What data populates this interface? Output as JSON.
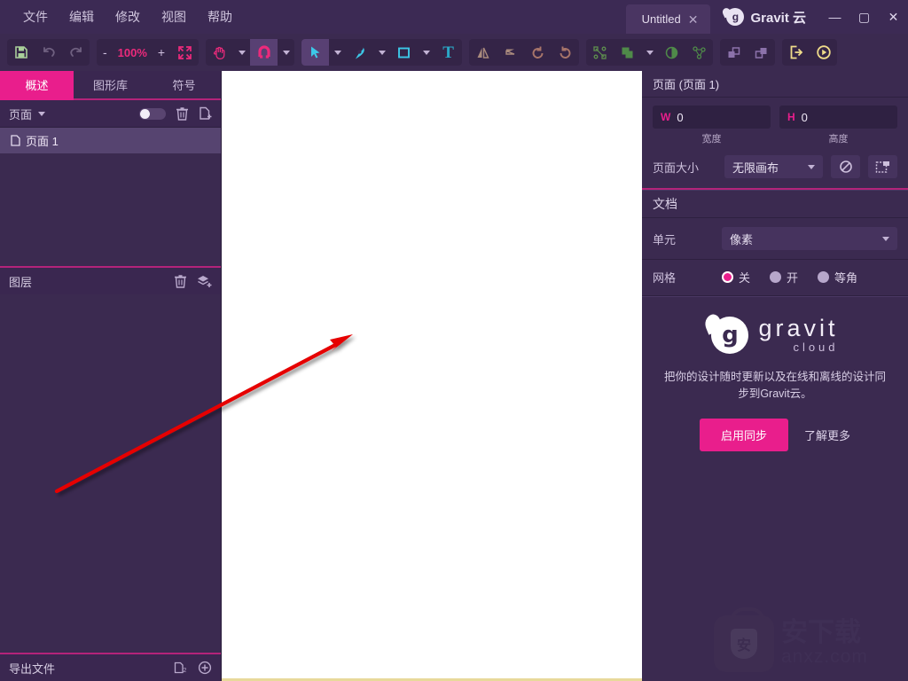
{
  "window": {
    "menus": [
      "文件",
      "编辑",
      "修改",
      "视图",
      "帮助"
    ],
    "document_tab": "Untitled",
    "document_tab_close": "✕",
    "brand": "Gravit 云",
    "brand_logo_letter": "g",
    "minimize": "—",
    "maximize": "▢",
    "close": "✕"
  },
  "toolbar": {
    "zoom_minus": "-",
    "zoom_value": "100%",
    "zoom_plus": "+",
    "icons": {
      "save": "save-icon",
      "undo": "undo-icon",
      "redo": "redo-icon",
      "fit": "fit-screen-icon",
      "hand": "hand-tool-icon",
      "magnet": "magnet-snap-icon",
      "select": "pointer-tool-icon",
      "pen": "pen-tool-icon",
      "rect": "rectangle-tool-icon",
      "text": "text-tool-icon",
      "flip_h": "flip-horizontal-icon",
      "flip_v": "flip-vertical-icon",
      "rotate_ccw": "rotate-left-icon",
      "rotate_cw": "rotate-right-icon",
      "node": "node-edit-icon",
      "boolean": "boolean-union-icon",
      "mask": "mask-icon",
      "distribute": "distribute-icon",
      "bring_forward": "bring-forward-icon",
      "send_backward": "send-backward-icon",
      "export": "export-icon",
      "preview": "preview-play-icon"
    },
    "text_tool_label": "T"
  },
  "left_panel": {
    "tabs": [
      {
        "label": "概述",
        "active": true
      },
      {
        "label": "图形库",
        "active": false
      },
      {
        "label": "符号",
        "active": false
      }
    ],
    "pages_header": "页面",
    "page_items": [
      {
        "label": "页面 1",
        "selected": true
      }
    ],
    "layers_header": "图层",
    "export_header": "导出文件"
  },
  "right_panel": {
    "title": "页面 (页面 1)",
    "width_prefix": "W",
    "width_value": "0",
    "height_prefix": "H",
    "height_value": "0",
    "width_label": "宽度",
    "height_label": "高度",
    "page_size_label": "页面大小",
    "page_size_value": "无限画布",
    "document_header": "文档",
    "unit_label": "单元",
    "unit_value": "像素",
    "grid_label": "网格",
    "grid_options": [
      {
        "label": "关",
        "selected": true
      },
      {
        "label": "开",
        "selected": false
      },
      {
        "label": "等角",
        "selected": false
      }
    ],
    "promo": {
      "logo_main": "gravit",
      "logo_sub": "cloud",
      "logo_letter": "g",
      "description": "把你的设计随时更新以及在线和离线的设计同步到Gravit云。",
      "primary_button": "启用同步",
      "secondary_link": "了解更多"
    }
  },
  "watermark": {
    "badge_text": "安",
    "title": "安下载",
    "subtitle": "anxz.com"
  },
  "colors": {
    "accent_pink": "#e91e8c",
    "panel_bg": "#3b2a50",
    "titlebar_bg": "#3c2a54",
    "canvas_bg": "#ffffff",
    "annotation_red": "#e60000",
    "canvas_edge": "#e8d99a"
  }
}
